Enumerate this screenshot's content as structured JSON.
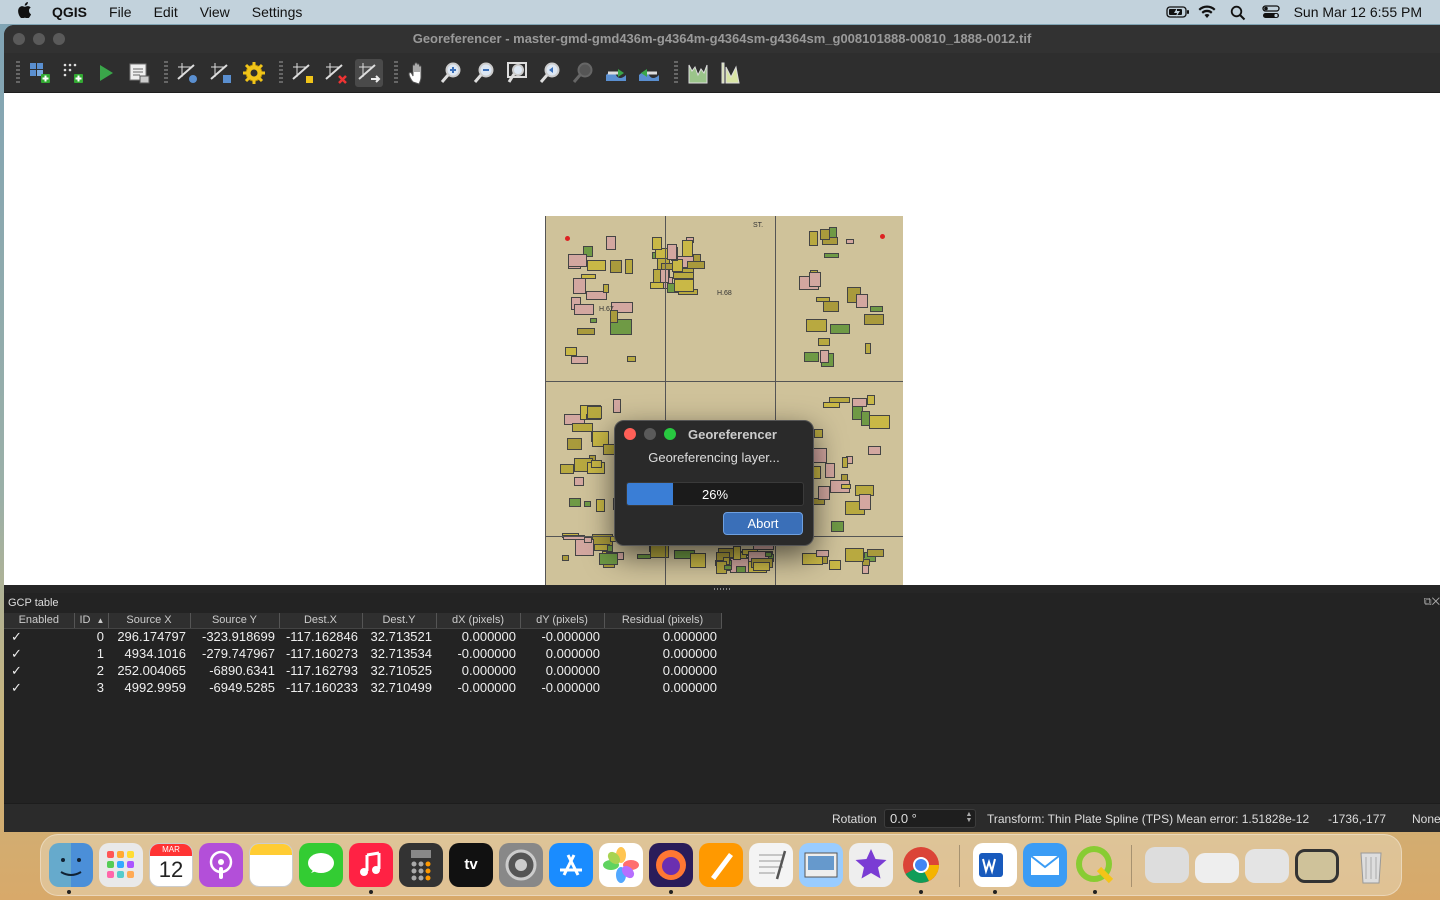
{
  "menubar": {
    "app_name": "QGIS",
    "menus": [
      "File",
      "Edit",
      "View",
      "Settings"
    ],
    "clock": "Sun Mar 12  6:55 PM"
  },
  "window": {
    "title": "Georeferencer - master-gmd-gmd436m-g4364m-g4364sm-g4364sm_g008101888-00810_1888-0012.tif"
  },
  "toolbar_icons": [
    "open-raster-icon",
    "start-georef-icon",
    "run-georef-icon",
    "generate-script-icon",
    "transformation-settings-icon",
    "add-point-icon",
    "delete-point-icon",
    "move-gcp-icon",
    "pan-icon",
    "zoom-in-icon",
    "zoom-out-icon",
    "zoom-to-layer-icon",
    "zoom-last-icon",
    "zoom-next-icon",
    "link-georef-to-qgis-icon",
    "link-qgis-to-georef-icon",
    "full-histogram-stretch-icon",
    "local-histogram-stretch-icon"
  ],
  "dialog": {
    "title": "Georeferencer",
    "message": "Georeferencing layer...",
    "progress_percent": 26,
    "progress_label": "26%",
    "abort_label": "Abort"
  },
  "gcp_table": {
    "title": "GCP table",
    "columns": [
      "Enabled",
      "ID",
      "Source X",
      "Source Y",
      "Dest.X",
      "Dest.Y",
      "dX (pixels)",
      "dY (pixels)",
      "Residual (pixels)"
    ],
    "rows": [
      {
        "enabled": "✓",
        "id": "0",
        "source_x": "296.174797",
        "source_y": "-323.918699",
        "dest_x": "-117.162846",
        "dest_y": "32.713521",
        "dx": "0.000000",
        "dy": "-0.000000",
        "residual": "0.000000"
      },
      {
        "enabled": "✓",
        "id": "1",
        "source_x": "4934.1016",
        "source_y": "-279.747967",
        "dest_x": "-117.160273",
        "dest_y": "32.713534",
        "dx": "-0.000000",
        "dy": "0.000000",
        "residual": "0.000000"
      },
      {
        "enabled": "✓",
        "id": "2",
        "source_x": "252.004065",
        "source_y": "-6890.6341",
        "dest_x": "-117.162793",
        "dest_y": "32.710525",
        "dx": "0.000000",
        "dy": "0.000000",
        "residual": "0.000000"
      },
      {
        "enabled": "✓",
        "id": "3",
        "source_x": "4992.9959",
        "source_y": "-6949.5285",
        "dest_x": "-117.160233",
        "dest_y": "32.710499",
        "dx": "-0.000000",
        "dy": "-0.000000",
        "residual": "0.000000"
      }
    ]
  },
  "statusbar": {
    "rotation_label": "Rotation",
    "rotation_value": "0.0 °",
    "transform_text": "Transform: Thin Plate Spline (TPS) Mean error: 1.51828e-12",
    "coords": "-1736,-177",
    "crs": "None"
  },
  "map": {
    "labels": [
      "H.68",
      "H.67",
      "ST."
    ]
  },
  "dock": {
    "calendar_month": "MAR",
    "calendar_day": "12",
    "tv_label": "tv",
    "apps": [
      "finder-icon",
      "launchpad-icon",
      "podcasts-icon",
      "notes-icon",
      "messages-icon",
      "music-icon",
      "calculator-icon",
      "apple-tv-icon",
      "system-settings-icon",
      "app-store-icon",
      "photos-icon",
      "firefox-icon",
      "pages-icon",
      "textedit-icon",
      "preview-icon",
      "imovie-icon",
      "chrome-icon",
      "word-icon",
      "mail-icon",
      "qgis-icon",
      "trash-icon"
    ]
  },
  "colors": {
    "progress": "#3a7ed6",
    "abort_button": "#3a6fb8",
    "close_red": "#ff5f57",
    "zoom_green": "#28c840",
    "map_paper": "#cfc29a"
  }
}
